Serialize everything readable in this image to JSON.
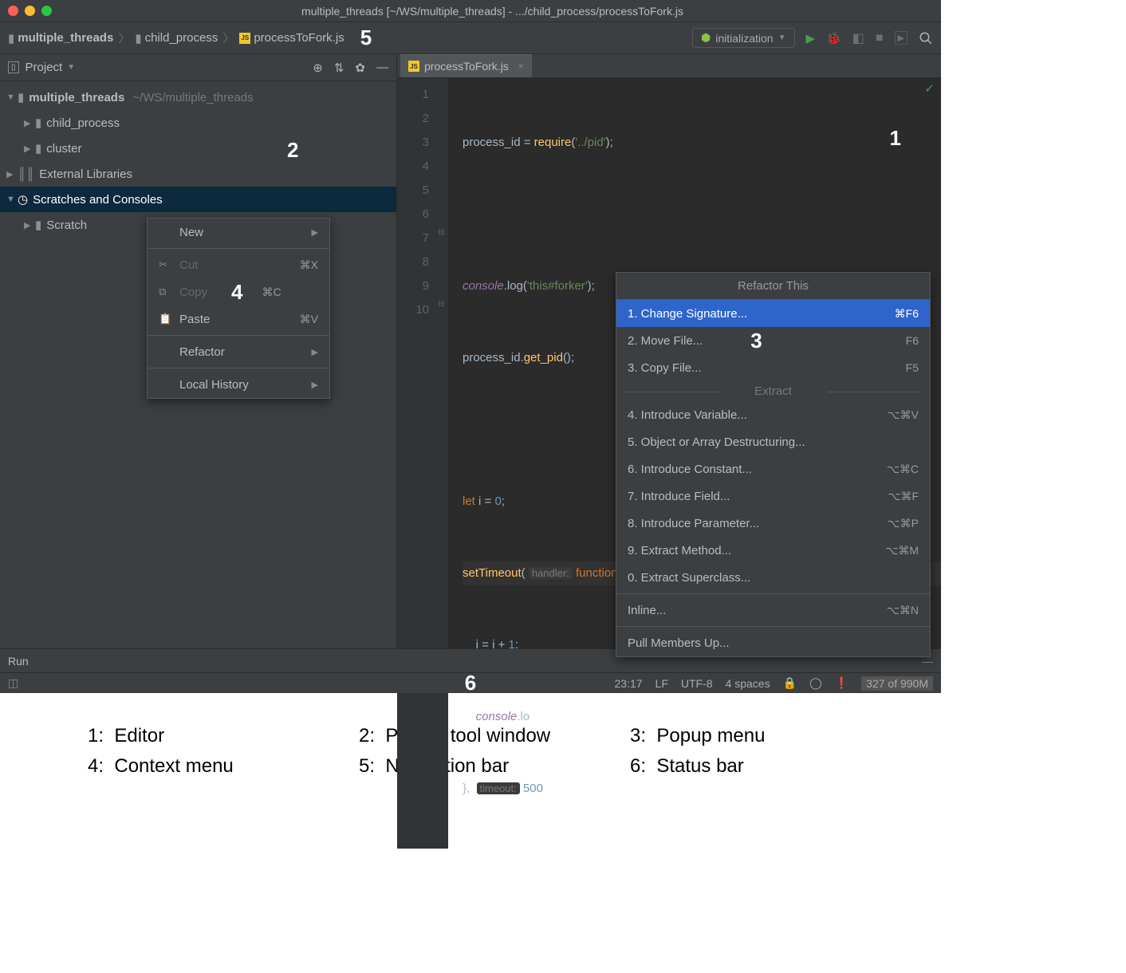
{
  "window": {
    "title": "multiple_threads [~/WS/multiple_threads] - .../child_process/processToFork.js"
  },
  "breadcrumb": {
    "items": [
      "multiple_threads",
      "child_process",
      "processToFork.js"
    ]
  },
  "nav_annotation": "5",
  "run_config": "initialization",
  "project_panel": {
    "header": "Project",
    "annotation": "2",
    "tree": {
      "root": "multiple_threads",
      "root_path": "~/WS/multiple_threads",
      "children": [
        "child_process",
        "cluster"
      ],
      "external": "External Libraries",
      "scratches": "Scratches and Consoles",
      "scratch_child": "Scratch"
    }
  },
  "context_menu": {
    "annotation": "4",
    "new": "New",
    "cut": "Cut",
    "cut_sc": "⌘X",
    "copy": "Copy",
    "copy_sc": "⌘C",
    "paste": "Paste",
    "paste_sc": "⌘V",
    "refactor": "Refactor",
    "local_history": "Local History"
  },
  "editor": {
    "annotation": "1",
    "tab": "processToFork.js",
    "lines": [
      "1",
      "2",
      "3",
      "4",
      "5",
      "6",
      "7",
      "8",
      "9",
      "10"
    ],
    "code": {
      "l1_a": "process_id",
      "l1_b": " = ",
      "l1_c": "require",
      "l1_d": "(",
      "l1_e": "'../pid'",
      "l1_f": ");",
      "l3_a": "console",
      "l3_b": ".log(",
      "l3_c": "'this#forker'",
      "l3_d": ");",
      "l4_a": "process_id",
      "l4_b": ".",
      "l4_c": "get_pid",
      "l4_d": "();",
      "l6_a": "let ",
      "l6_b": "i = ",
      "l6_c": "0",
      "l6_d": ";",
      "l7_a": "setTimeout",
      "l7_b": "(",
      "l7_hint": "handler:",
      "l7_c": " function",
      "l7_d": "() {",
      "l8_a": "    i = i + ",
      "l8_b": "1",
      "l8_c": ";",
      "l9_a": "    ",
      "l9_b": "console",
      "l9_c": ".lo",
      "l10_a": "},  ",
      "l10_hint": "timeout:",
      "l10_b": " 500"
    }
  },
  "refactor_popup": {
    "annotation": "3",
    "title": "Refactor This",
    "items": [
      {
        "label": "1. Change Signature...",
        "sc": "⌘F6",
        "selected": true
      },
      {
        "label": "2. Move File...",
        "sc": "F6"
      },
      {
        "label": "3. Copy File...",
        "sc": "F5"
      }
    ],
    "section": "Extract",
    "extract": [
      {
        "label": "4. Introduce Variable...",
        "sc": "⌥⌘V"
      },
      {
        "label": "5. Object or Array Destructuring..."
      },
      {
        "label": "6. Introduce Constant...",
        "sc": "⌥⌘C"
      },
      {
        "label": "7. Introduce Field...",
        "sc": "⌥⌘F"
      },
      {
        "label": "8. Introduce Parameter...",
        "sc": "⌥⌘P"
      },
      {
        "label": "9. Extract Method...",
        "sc": "⌥⌘M"
      },
      {
        "label": "0. Extract Superclass..."
      }
    ],
    "inline": {
      "label": "Inline...",
      "sc": "⌥⌘N"
    },
    "pull": "Pull Members Up..."
  },
  "run_bar": "Run",
  "status": {
    "annotation": "6",
    "pos": "23:17",
    "sep": "LF",
    "enc": "UTF-8",
    "indent": "4 spaces",
    "mem": "327 of 990M"
  },
  "legend": {
    "row1": [
      {
        "n": "1:",
        "t": "Editor"
      },
      {
        "n": "2:",
        "t": "Project tool window"
      },
      {
        "n": "3:",
        "t": "Popup menu"
      }
    ],
    "row2": [
      {
        "n": "4:",
        "t": "Context menu"
      },
      {
        "n": "5:",
        "t": "Navigation bar"
      },
      {
        "n": "6:",
        "t": "Status bar"
      }
    ]
  }
}
